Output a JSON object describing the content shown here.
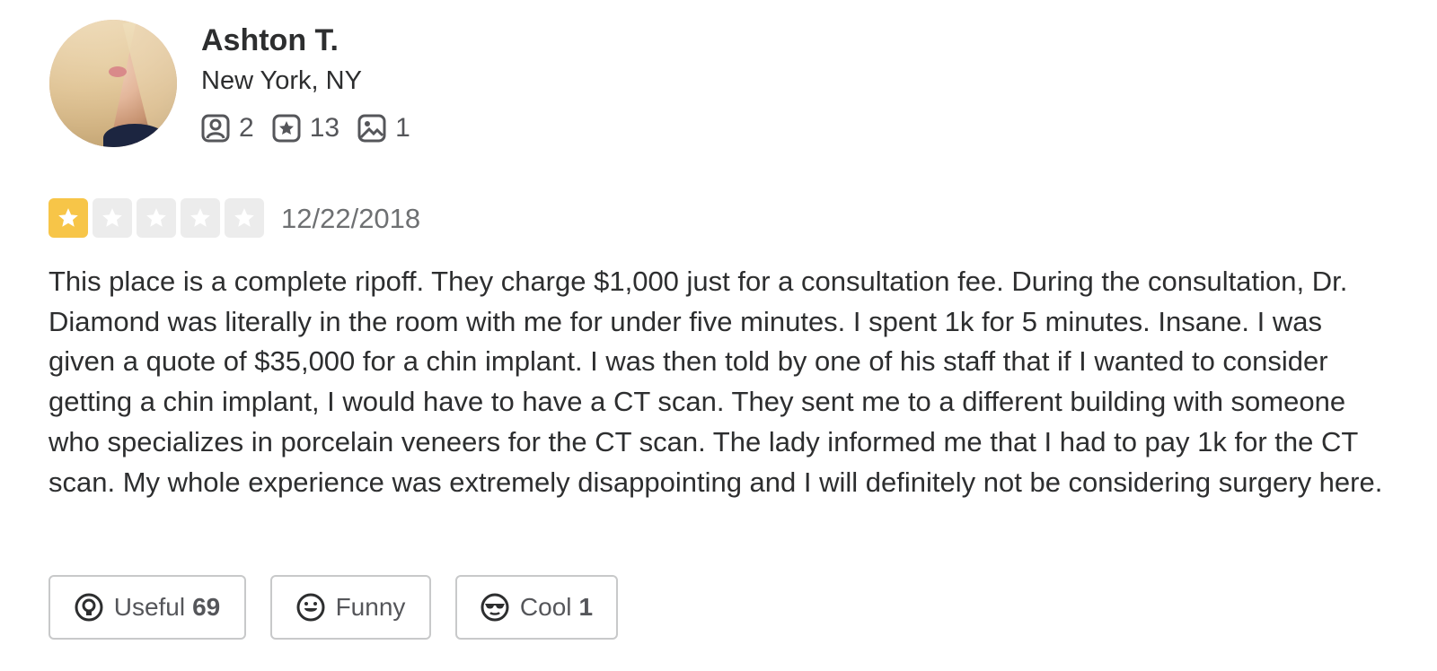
{
  "user": {
    "name": "Ashton T.",
    "location": "New York, NY",
    "stats": {
      "friends": {
        "icon": "friends-icon",
        "count": "2"
      },
      "reviews": {
        "icon": "review-star-icon",
        "count": "13"
      },
      "photos": {
        "icon": "photo-icon",
        "count": "1"
      }
    }
  },
  "review": {
    "rating": 1,
    "max_rating": 5,
    "date": "12/22/2018",
    "text": "This place is a complete ripoff.  They charge $1,000 just for a consultation fee.  During the consultation, Dr. Diamond was literally in the room with me for under five minutes.  I spent 1k for 5 minutes.  Insane. I was given a quote of $35,000 for a chin implant. I was then told by one of his staff that if I wanted to consider getting a chin implant, I would have to have a CT scan. They sent me to a different building with someone who specializes in porcelain veneers for the CT scan.  The lady informed me that I had to pay 1k for the CT scan.  My whole experience was extremely disappointing and I will definitely not be considering surgery here."
  },
  "reactions": {
    "useful": {
      "label": "Useful",
      "count": "69",
      "icon": "useful-icon"
    },
    "funny": {
      "label": "Funny",
      "count": "",
      "icon": "funny-icon"
    },
    "cool": {
      "label": "Cool",
      "count": "1",
      "icon": "cool-icon"
    }
  },
  "colors": {
    "star_on": "#f7c548",
    "star_off": "#ececec",
    "text": "#2d2e2f",
    "muted": "#6e7072"
  }
}
